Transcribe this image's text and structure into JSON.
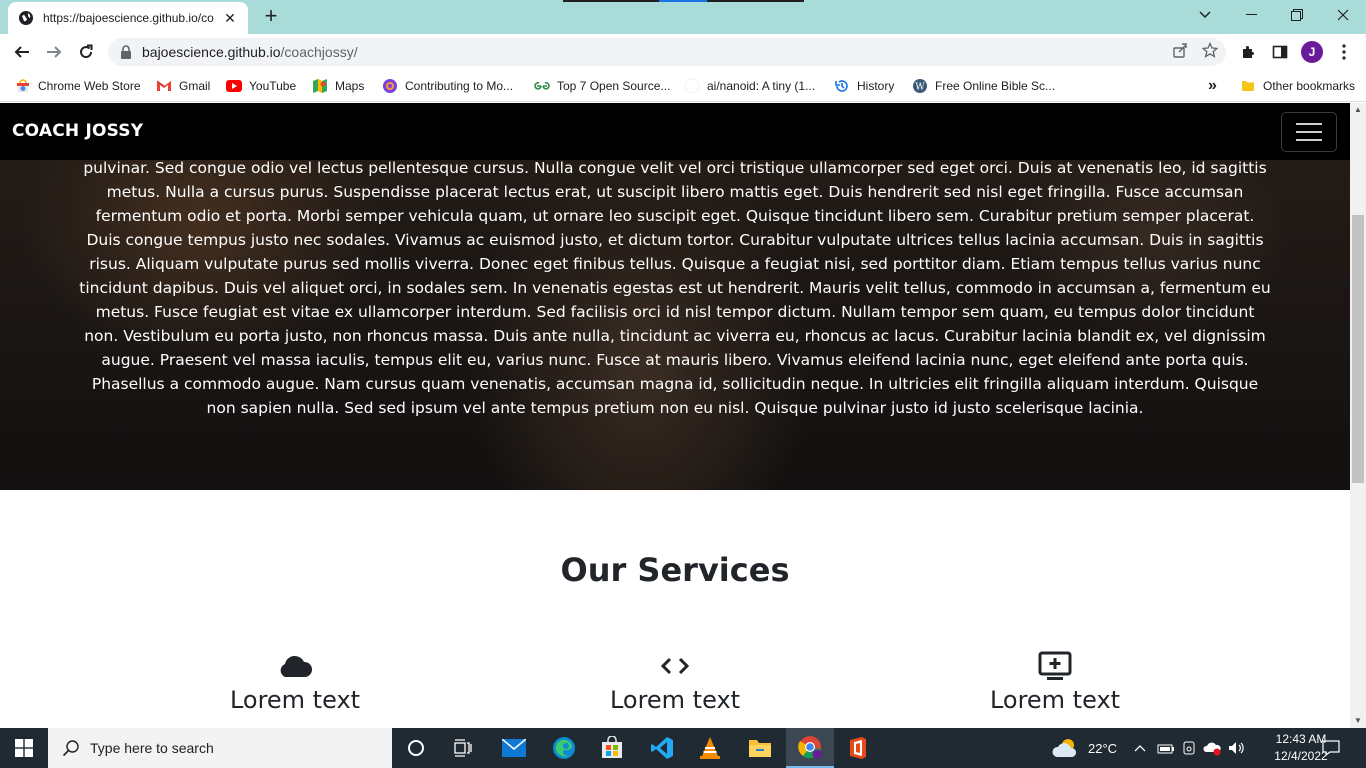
{
  "browser": {
    "tab": {
      "title": "https://bajoescience.github.io/co",
      "close_glyph": "✕"
    },
    "new_tab_glyph": "+",
    "address": {
      "host": "bajoescience.github.io",
      "path": "/coachjossy/"
    },
    "profile_initial": "J",
    "bookmarks": [
      {
        "label": "Chrome Web Store",
        "icon": "chrome-web-store-icon"
      },
      {
        "label": "Gmail",
        "icon": "gmail-icon"
      },
      {
        "label": "YouTube",
        "icon": "youtube-icon"
      },
      {
        "label": "Maps",
        "icon": "maps-icon"
      },
      {
        "label": "Contributing to Mo...",
        "icon": "firefox-icon"
      },
      {
        "label": "Top 7 Open Source...",
        "icon": "gfg-icon"
      },
      {
        "label": "ai/nanoid: A tiny (1...",
        "icon": "github-icon"
      },
      {
        "label": "History",
        "icon": "history-icon"
      },
      {
        "label": "Free Online Bible Sc...",
        "icon": "wordpress-icon"
      }
    ],
    "overflow_glyph": "»",
    "other_bookmarks": "Other bookmarks"
  },
  "page": {
    "brand": "COACH JOSSY",
    "hero_text": "pulvinar. Sed congue odio vel lectus pellentesque cursus. Nulla congue velit vel orci tristique ullamcorper sed eget orci. Duis at venenatis leo, id sagittis metus. Nulla a cursus purus. Suspendisse placerat lectus erat, ut suscipit libero mattis eget. Duis hendrerit sed nisl eget fringilla. Fusce accumsan fermentum odio et porta. Morbi semper vehicula quam, ut ornare leo suscipit eget. Quisque tincidunt libero sem. Curabitur pretium semper placerat. Duis congue tempus justo nec sodales. Vivamus ac euismod justo, et dictum tortor. Curabitur vulputate ultrices tellus lacinia accumsan. Duis in sagittis risus. Aliquam vulputate purus sed mollis viverra. Donec eget finibus tellus. Quisque a feugiat nisi, sed porttitor diam. Etiam tempus tellus varius nunc tincidunt dapibus. Duis vel aliquet orci, in sodales sem. In venenatis egestas est ut hendrerit. Mauris velit tellus, commodo in accumsan a, fermentum eu metus. Fusce feugiat est vitae ex ullamcorper interdum. Sed facilisis orci id nisl tempor dictum. Nullam tempor sem quam, eu tempus dolor tincidunt non. Vestibulum eu porta justo, non rhoncus massa. Duis ante nulla, tincidunt ac viverra eu, rhoncus ac lacus. Curabitur lacinia blandit ex, vel dignissim augue. Praesent vel massa iaculis, tempus elit eu, varius nunc. Fusce at mauris libero. Vivamus eleifend lacinia nunc, eget eleifend ante porta quis. Phasellus a commodo augue. Nam cursus quam venenatis, accumsan magna id, sollicitudin neque. In ultricies elit fringilla aliquam interdum. Quisque non sapien nulla. Sed sed ipsum vel ante tempus pretium non eu nisl. Quisque pulvinar justo id justo scelerisque lacinia.",
    "services_title": "Our Services",
    "services": [
      {
        "label": "Lorem text",
        "icon": "cloud-icon"
      },
      {
        "label": "Lorem text",
        "icon": "code-icon"
      },
      {
        "label": "Lorem text",
        "icon": "monitor-plus-icon"
      }
    ]
  },
  "taskbar": {
    "search_placeholder": "Type here to search",
    "weather": "22°C",
    "time": "12:43 AM",
    "date": "12/4/2022"
  }
}
